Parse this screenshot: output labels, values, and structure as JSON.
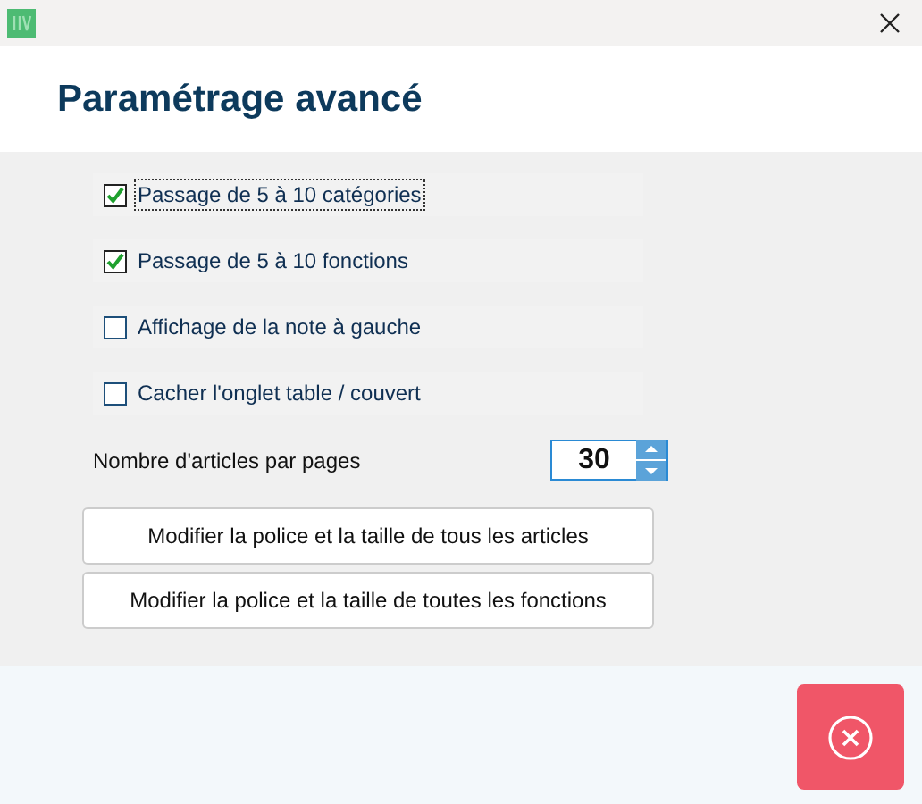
{
  "window": {
    "title_heading": "Paramétrage avancé"
  },
  "options": [
    {
      "label": "Passage de 5 à 10 catégories",
      "checked": true,
      "focused": true
    },
    {
      "label": "Passage de 5 à 10 fonctions",
      "checked": true,
      "focused": false
    },
    {
      "label": "Affichage de la note à gauche",
      "checked": false,
      "focused": false
    },
    {
      "label": "Cacher l'onglet table / couvert",
      "checked": false,
      "focused": false
    }
  ],
  "articles_per_page": {
    "label": "Nombre d'articles par pages",
    "value": "30"
  },
  "buttons": [
    "Modifier la police et la taille de tous les articles",
    "Modifier la police et la taille de toutes les fonctions"
  ]
}
